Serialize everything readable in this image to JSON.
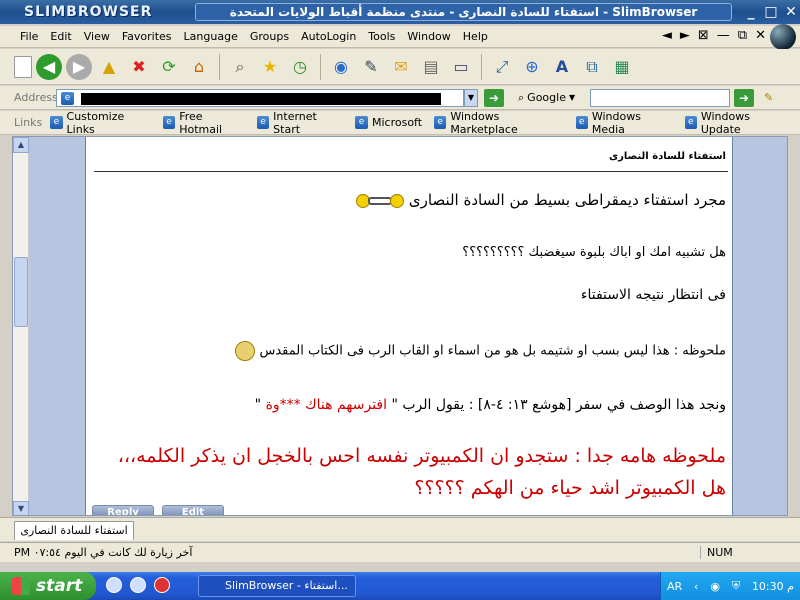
{
  "window": {
    "brand": "SLIMBROWSER",
    "title": "استفتاء للسادة النصارى - منتدى منظمة أقباط الولايات المتحدة - SlimBrowser",
    "buttons": {
      "minimize": "_",
      "maximize": "□",
      "close": "✕"
    }
  },
  "menubar": {
    "items": [
      "File",
      "Edit",
      "View",
      "Favorites",
      "Language",
      "Groups",
      "AutoLogin",
      "Tools",
      "Window",
      "Help"
    ],
    "nav": [
      "◄",
      "►",
      "⊠",
      "—",
      "⧉",
      "✕"
    ]
  },
  "toolbar": {
    "icons": [
      "new-page-icon",
      "back-icon",
      "forward-icon",
      "up-folder-icon",
      "stop-icon",
      "refresh-icon",
      "home-icon",
      "search-icon",
      "favorites-star-icon",
      "history-icon",
      "globe-icon",
      "edit-icon",
      "mail-icon",
      "print-icon",
      "tools-icon",
      "resize-icon",
      "zoom-icon",
      "font-icon",
      "window-icon",
      "tile-icon"
    ]
  },
  "addressbar": {
    "label": "Address",
    "search_engine": "Google"
  },
  "linksbar": {
    "label": "Links",
    "items": [
      "Customize Links",
      "Free Hotmail",
      "Internet Start",
      "Microsoft",
      "Windows Marketplace",
      "Windows Media",
      "Windows Update"
    ]
  },
  "post": {
    "title": "استفتاء للسادة النصارى",
    "lines": [
      "مجرد استفتاء ديمقراطى بسيط من السادة النصارى",
      "هل تشبيه امك او اباك بلبوة سيغضبك ؟؟؟؟؟؟؟؟؟",
      "فى انتظار نتيجه الاستفتاء",
      "ملحوظه : هذا ليس بسب او شتيمه بل هو من اسماء او القاب الرب فى الكتاب المقدس",
      "ونجد هذا الوصف في سفر [هوشع ١٣: ٤-٨] : يقول الرب \"",
      "افترسهم هناك ***وة",
      "\"",
      "ملحوظه هامه جدا : ستجدو ان الكمبيوتر نفسه احس بالخجل ان يذكر الكلمه،،،",
      "هل الكمبيوتر اشد حياء من الهكم ؟؟؟؟؟"
    ],
    "colors": {
      "red": "#cc0000",
      "text": "#000000"
    },
    "buttons": [
      "Reply",
      "Edit"
    ]
  },
  "tab": {
    "label": "استفتاء للسادة النصارى"
  },
  "statusbar": {
    "text": "آخر زيارة لك كانت في اليوم ٠٧:٥٤ PM",
    "num": "NUM"
  },
  "taskbar": {
    "start": "start",
    "task": "SlimBrowser - استفتاء...",
    "lang": "AR",
    "time": "10:30 م"
  }
}
